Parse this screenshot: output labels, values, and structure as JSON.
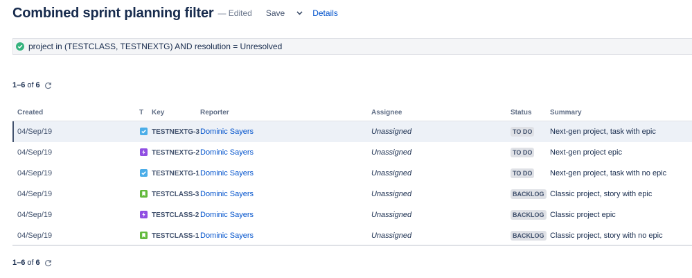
{
  "header": {
    "title": "Combined sprint planning filter",
    "edited": "— Edited",
    "save_label": "Save",
    "details_label": "Details"
  },
  "query": {
    "text": "project in (TESTCLASS, TESTNEXTG) AND resolution = Unresolved",
    "status_icon": "check-circle-icon",
    "status_color": "#36b37e"
  },
  "pager": {
    "range": "1–6",
    "of": "of",
    "total": "6"
  },
  "table": {
    "columns": {
      "created": "Created",
      "type": "T",
      "key": "Key",
      "reporter": "Reporter",
      "assignee": "Assignee",
      "status": "Status",
      "summary": "Summary"
    },
    "rows": [
      {
        "created": "04/Sep/19",
        "type": "task",
        "key": "TESTNEXTG-3",
        "reporter": "Dominic Sayers",
        "assignee": "Unassigned",
        "status": "TO DO",
        "summary": "Next-gen project, task with epic"
      },
      {
        "created": "04/Sep/19",
        "type": "epic",
        "key": "TESTNEXTG-2",
        "reporter": "Dominic Sayers",
        "assignee": "Unassigned",
        "status": "TO DO",
        "summary": "Next-gen project epic"
      },
      {
        "created": "04/Sep/19",
        "type": "task",
        "key": "TESTNEXTG-1",
        "reporter": "Dominic Sayers",
        "assignee": "Unassigned",
        "status": "TO DO",
        "summary": "Next-gen project, task with no epic"
      },
      {
        "created": "04/Sep/19",
        "type": "story",
        "key": "TESTCLASS-3",
        "reporter": "Dominic Sayers",
        "assignee": "Unassigned",
        "status": "BACKLOG",
        "summary": "Classic project, story with epic"
      },
      {
        "created": "04/Sep/19",
        "type": "epic",
        "key": "TESTCLASS-2",
        "reporter": "Dominic Sayers",
        "assignee": "Unassigned",
        "status": "BACKLOG",
        "summary": "Classic project epic"
      },
      {
        "created": "04/Sep/19",
        "type": "story",
        "key": "TESTCLASS-1",
        "reporter": "Dominic Sayers",
        "assignee": "Unassigned",
        "status": "BACKLOG",
        "summary": "Classic project, story with no epic"
      }
    ]
  },
  "colors": {
    "link": "#0052cc",
    "task": "#4bade8",
    "epic": "#904ee2",
    "story": "#63ba3c"
  }
}
